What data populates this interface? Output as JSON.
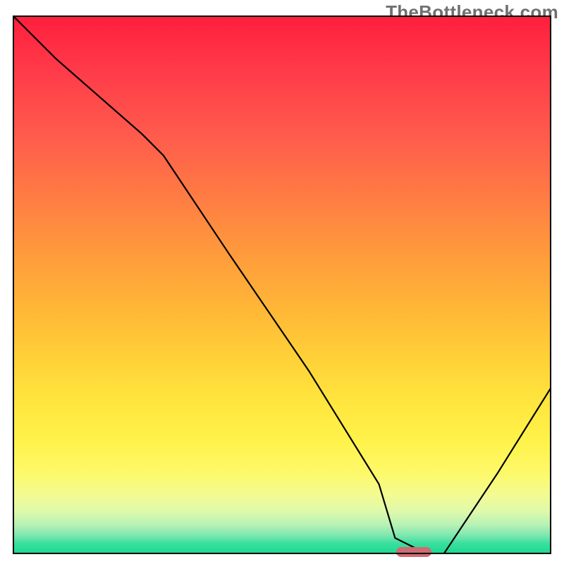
{
  "watermark": "TheBottleneck.com",
  "chart_data": {
    "type": "line",
    "title": "",
    "xlabel": "",
    "ylabel": "",
    "xlim": [
      0,
      100
    ],
    "ylim": [
      0,
      100
    ],
    "grid": false,
    "legend": false,
    "background_gradient": {
      "top": "#ff1e3c",
      "mid": "#ffd238",
      "bottom": "#18d98d"
    },
    "series": [
      {
        "name": "bottleneck-curve",
        "x": [
          0,
          8,
          24,
          28,
          40,
          55,
          68,
          71,
          77,
          80,
          90,
          100
        ],
        "values": [
          100,
          92,
          78,
          74,
          56,
          34,
          13,
          3,
          0,
          0,
          15,
          31
        ]
      }
    ],
    "marker": {
      "name": "optimal-point",
      "x": 74.5,
      "y": 0,
      "width_pct": 6.5,
      "color": "#cf6b72"
    }
  }
}
